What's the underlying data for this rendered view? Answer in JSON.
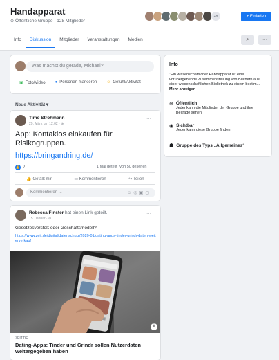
{
  "group": {
    "title": "Handapparat",
    "subtitle": "Öffentliche Gruppe · 128 Mitglieder",
    "member_more": "+8",
    "invite_label": "+ Einladen"
  },
  "tabs": [
    "Info",
    "Diskussion",
    "Mitglieder",
    "Veranstaltungen",
    "Medien"
  ],
  "toolbar": {
    "search_icon": "⌕",
    "more_icon": "···"
  },
  "composer": {
    "placeholder": "Was machst du gerade, Michael?",
    "actions": [
      "Foto/Video",
      "Personen markieren",
      "Gefühl/Aktivität"
    ]
  },
  "feed": {
    "section": "Neue Aktivität ▾"
  },
  "post1": {
    "author": "Timo Strohmann",
    "meta": "29. März um 12:02 · ⊕",
    "text": "App: Kontaklos einkaufen für Risikogruppen.",
    "link": "https://bringandring.de/",
    "likes": "2",
    "stats": "1 Mal geteilt  Von 50 gesehen",
    "actions": [
      "Gefällt mir",
      "Kommentieren",
      "Teilen"
    ],
    "comment_placeholder": "Kommentieren ..."
  },
  "post2": {
    "author": "Rebecca Finster",
    "author_suffix": " hat einen Link geteilt.",
    "meta": "15. Januar · ⊕",
    "text": "Gesetzesverstoß oder Geschäftsmodell?",
    "link": "https://www.zeit.de/digital/datenschutz/2020-01/dating-apps-tinder-grindr-daten-weiterverkauf",
    "source": "ZEIT.DE",
    "headline": "Dating-Apps: Tinder und Grindr sollen Nutzerdaten weitergegeben haben"
  },
  "info": {
    "heading": "Info",
    "description": "\"Ein wissenschaftlicher Handapparat ist eine vorübergehende Zusammenstellung von Büchern aus einer wissenschaftlichen Bibliothek zu einem bestim...",
    "more": "Mehr anzeigen",
    "items": [
      {
        "title": "Öffentlich",
        "desc": "Jeder kann die Mitglieder der Gruppe und ihre Beiträge sehen."
      },
      {
        "title": "Sichtbar",
        "desc": "Jeder kann diese Gruppe finden"
      },
      {
        "title": "Gruppe des Typs „Allgemeines“",
        "desc": ""
      }
    ]
  },
  "colors": {
    "accent": "#1877f2",
    "background": "#f0f2f5"
  }
}
